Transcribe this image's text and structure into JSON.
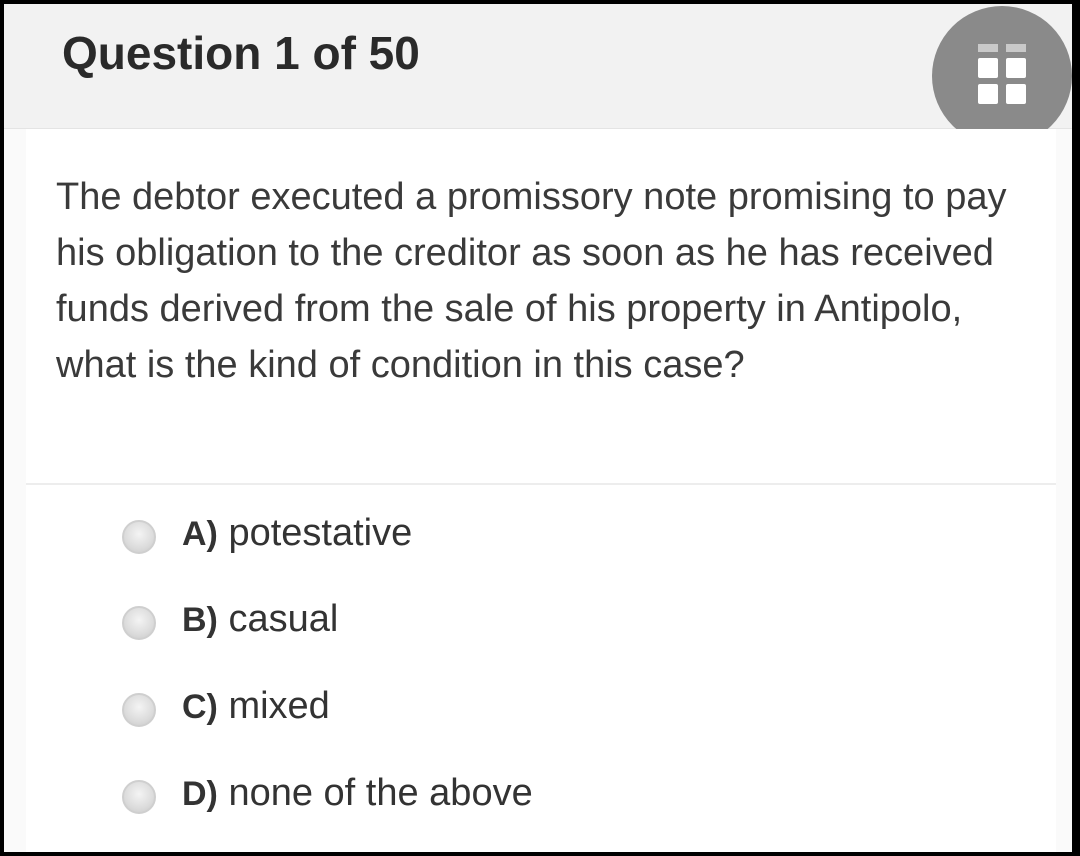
{
  "quiz": {
    "progress_label": "Question 1 of 50",
    "grid_icon": "grid-icon",
    "question": "The debtor executed a promissory note promising to pay his obligation to the creditor as soon as he has received funds derived from the sale of his property in Antipolo, what is the kind of condition in this case?",
    "options": [
      {
        "letter": "A)",
        "text": "potestative"
      },
      {
        "letter": "B)",
        "text": "casual"
      },
      {
        "letter": "C)",
        "text": "mixed"
      },
      {
        "letter": "D)",
        "text": "none of the above"
      }
    ]
  },
  "colors": {
    "header_bg": "#f2f2f2",
    "grid_button": "#8a8a8a",
    "text": "#3a3a3a"
  }
}
